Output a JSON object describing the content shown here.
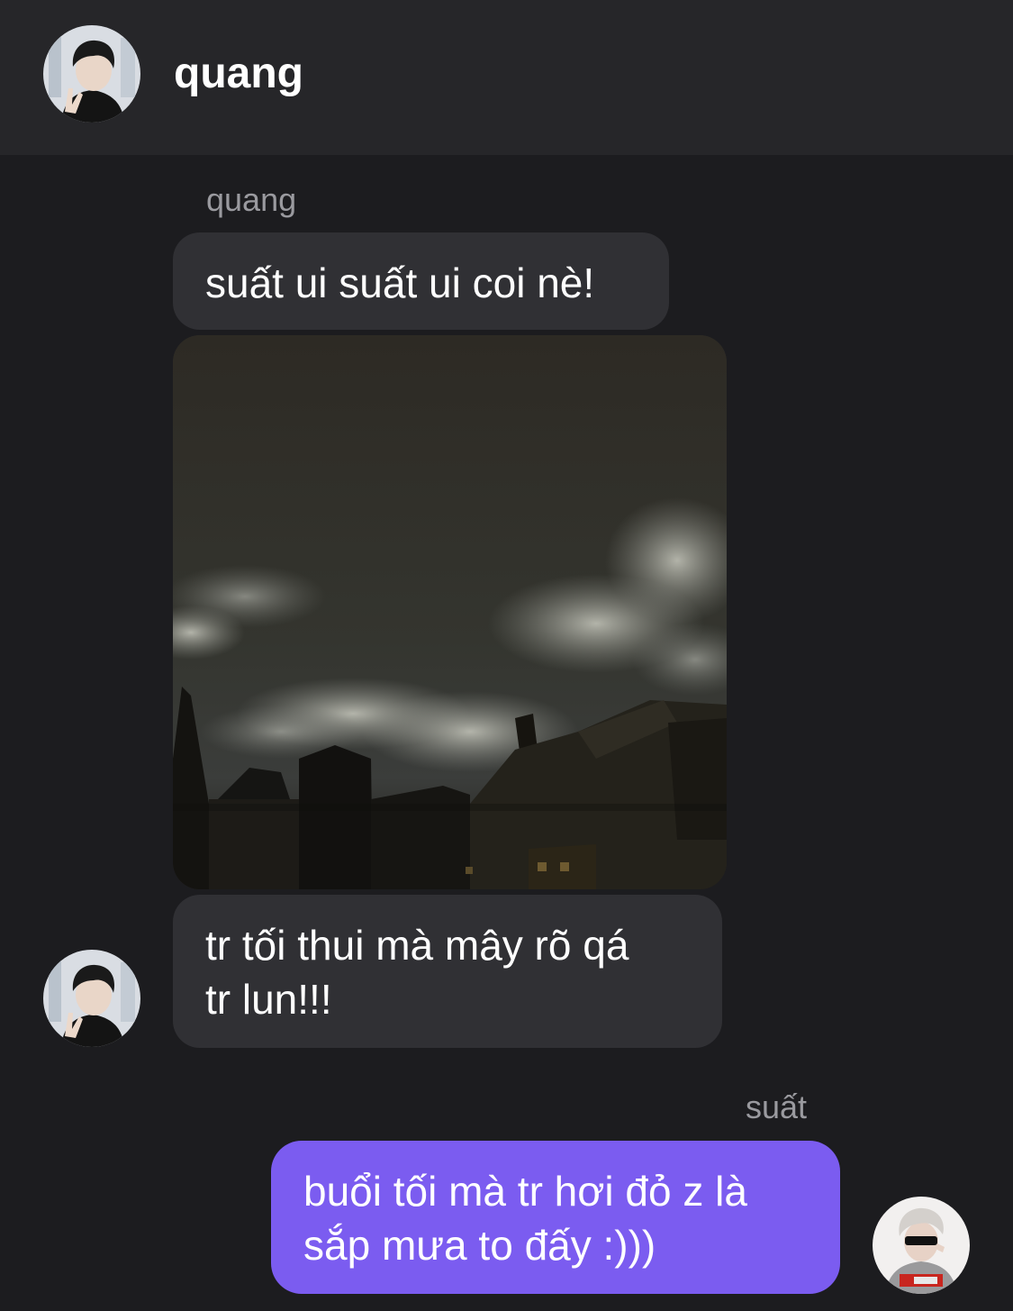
{
  "header": {
    "contact_name": "quang",
    "avatar_icon": "person-avatar-icon"
  },
  "messages": [
    {
      "sender": "quang",
      "direction": "incoming",
      "type": "text",
      "text": "suất ui suất ui coi nè!"
    },
    {
      "sender": "quang",
      "direction": "incoming",
      "type": "image",
      "image_desc": "night-sky-clouds-photo"
    },
    {
      "sender": "quang",
      "direction": "incoming",
      "type": "text",
      "text_lines": [
        "tr tối thui mà mây rõ qá",
        "tr lun!!!"
      ]
    },
    {
      "sender": "suất",
      "direction": "outgoing",
      "type": "text",
      "text_lines": [
        "buổi tối mà tr hơi đỏ z là",
        "sắp mưa to đấy :)))"
      ]
    }
  ],
  "labels": {
    "incoming_sender": "quang",
    "outgoing_sender": "suất"
  },
  "colors": {
    "background": "#1c1c1f",
    "header": "#262629",
    "incoming_bubble": "#303034",
    "outgoing_bubble": "#7b5cf0",
    "sender_label": "#9a9a9f"
  }
}
